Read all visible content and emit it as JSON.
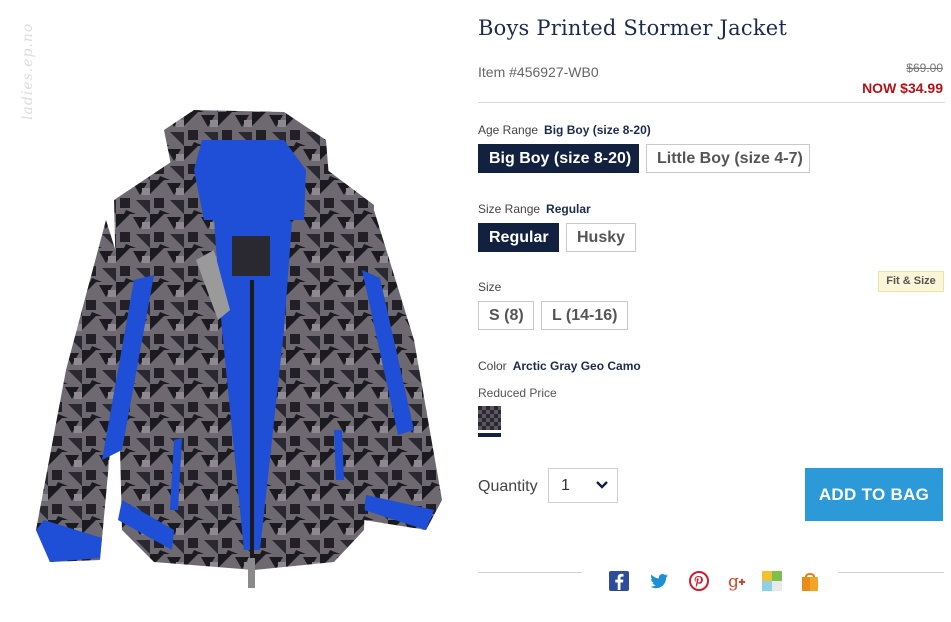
{
  "watermark": "ladies.ep.no",
  "product": {
    "title": "Boys Printed Stormer Jacket",
    "item_number": "Item #456927-WB0",
    "price_original": "$69.00",
    "price_now": "NOW $34.99"
  },
  "age_range": {
    "label": "Age Range",
    "selected": "Big Boy (size 8-20)",
    "options": [
      "Big Boy (size 8-20)",
      "Little Boy (size 4-7)"
    ]
  },
  "size_range": {
    "label": "Size Range",
    "selected": "Regular",
    "options": [
      "Regular",
      "Husky"
    ]
  },
  "size": {
    "label": "Size",
    "options": [
      "S (8)",
      "L (14-16)"
    ],
    "fit_link": "Fit & Size"
  },
  "color": {
    "label": "Color",
    "selected": "Arctic Gray Geo Camo",
    "group_label": "Reduced Price"
  },
  "quantity": {
    "label": "Quantity",
    "value": "1"
  },
  "add_to_bag": "ADD TO BAG",
  "share_icons": [
    "facebook-icon",
    "twitter-icon",
    "pinterest-icon",
    "google-plus-icon",
    "share-grid-icon",
    "shopping-bag-icon"
  ],
  "colors": {
    "navy": "#11213f",
    "accent_blue": "#2c9ad9",
    "sale_red": "#b0141a",
    "jacket_blue": "#1f4fd6"
  }
}
